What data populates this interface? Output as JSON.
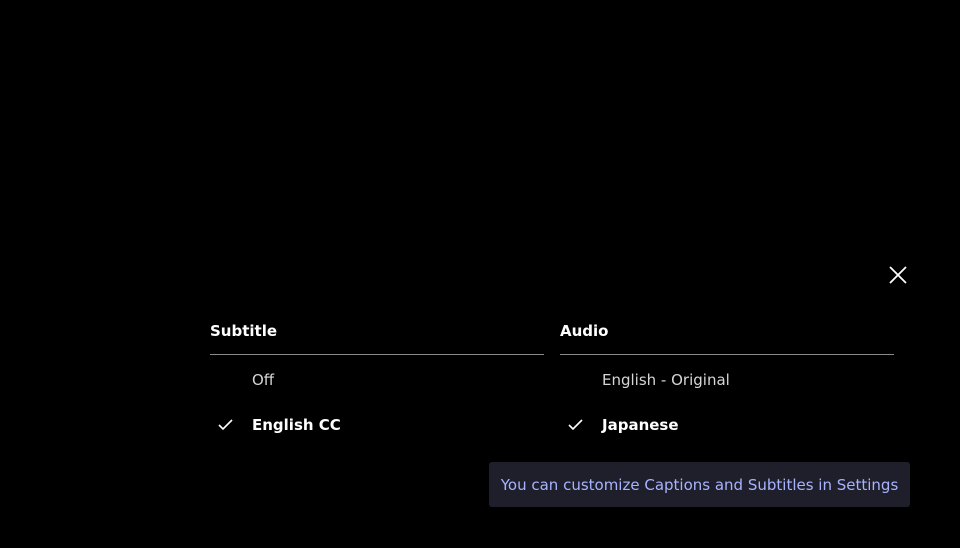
{
  "close_icon": "close-icon",
  "subtitle": {
    "header": "Subtitle",
    "options": [
      {
        "label": "Off",
        "selected": false
      },
      {
        "label": "English CC",
        "selected": true
      }
    ]
  },
  "audio": {
    "header": "Audio",
    "options": [
      {
        "label": "English - Original",
        "selected": false
      },
      {
        "label": "Japanese",
        "selected": true
      }
    ]
  },
  "tip": {
    "text": "You can customize Captions and Subtitles in Settings"
  },
  "colors": {
    "background": "#000000",
    "tip_background": "#1f1f2b",
    "tip_text": "#a7b3ff",
    "divider": "#8a8a8a"
  }
}
